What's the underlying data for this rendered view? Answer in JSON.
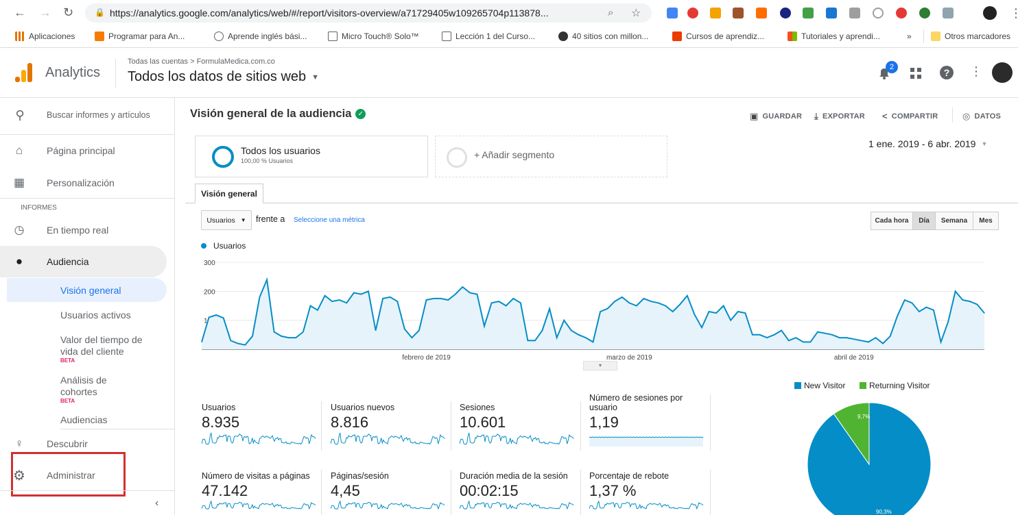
{
  "browser": {
    "url": "https://analytics.google.com/analytics/web/#/report/visitors-overview/a71729405w109265704p113878...",
    "bookmarks": [
      {
        "label": "Aplicaciones",
        "color": "#e37400"
      },
      {
        "label": "Programar para An...",
        "color": "#f57c00"
      },
      {
        "label": "Aprende inglés bási...",
        "color": "#5f6368"
      },
      {
        "label": "Micro Touch® Solo™",
        "color": "#5f6368"
      },
      {
        "label": "Lección 1 del Curso...",
        "color": "#5f6368"
      },
      {
        "label": "40 sitios con millon...",
        "color": "#333333"
      },
      {
        "label": "Cursos de aprendiz...",
        "color": "#eb3c00"
      },
      {
        "label": "Tutoriales y aprendi...",
        "color": "#f4b400"
      }
    ],
    "more_label": "»",
    "other_bookmarks": "Otros marcadores"
  },
  "header": {
    "app_name": "Analytics",
    "breadcrumb": "Todas las cuentas > FormulaMedica.com.co",
    "view_name": "Todos los datos de sitios web",
    "notification_count": "2"
  },
  "sidebar": {
    "search_placeholder": "Buscar informes y artículos",
    "home": "Página principal",
    "customization": "Personalización",
    "reports_heading": "INFORMES",
    "realtime": "En tiempo real",
    "audience": "Audiencia",
    "sub": {
      "overview": "Visión general",
      "active_users": "Usuarios activos",
      "lifetime_value": "Valor del tiempo de vida del cliente",
      "cohort": "Análisis de cohortes",
      "audiences": "Audiencias"
    },
    "beta_label": "BETA",
    "discover": "Descubrir",
    "admin": "Administrar",
    "collapse_icon": "chevron-left-icon"
  },
  "report": {
    "title": "Visión general de la audiencia",
    "actions": {
      "save": "GUARDAR",
      "export": "EXPORTAR",
      "share": "COMPARTIR",
      "insights": "DATOS"
    },
    "segment_name": "Todos los usuarios",
    "segment_sub": "100,00 % Usuarios",
    "add_segment": "+ Añadir segmento",
    "date_range": "1 ene. 2019 - 6 abr. 2019",
    "tab_overview": "Visión general",
    "metric_select": "Usuarios",
    "vs_label": "frente a",
    "select_metric_link": "Seleccione una métrica",
    "granularity": [
      "Cada hora",
      "Día",
      "Semana",
      "Mes"
    ],
    "granularity_selected": "Día"
  },
  "chart_data": {
    "type": "area",
    "series": [
      {
        "name": "Usuarios",
        "color": "#058dc7",
        "values": [
          25,
          110,
          118,
          108,
          30,
          20,
          15,
          45,
          180,
          240,
          60,
          45,
          40,
          40,
          60,
          150,
          135,
          185,
          165,
          170,
          160,
          195,
          190,
          200,
          65,
          175,
          180,
          165,
          70,
          40,
          65,
          170,
          175,
          175,
          170,
          190,
          215,
          195,
          190,
          80,
          160,
          165,
          150,
          175,
          160,
          30,
          30,
          65,
          140,
          40,
          100,
          65,
          50,
          40,
          25,
          130,
          140,
          165,
          180,
          160,
          150,
          175,
          165,
          160,
          150,
          130,
          155,
          185,
          120,
          75,
          130,
          125,
          150,
          100,
          130,
          125,
          50,
          50,
          40,
          50,
          65,
          30,
          40,
          25,
          25,
          60,
          55,
          50,
          40,
          40,
          35,
          30,
          25,
          40,
          20,
          45,
          115,
          170,
          160,
          130,
          145,
          135,
          25,
          95,
          200,
          170,
          165,
          155,
          125
        ]
      }
    ],
    "x_tick_labels": [
      "febrero de 2019",
      "marzo de 2019",
      "abril de 2019"
    ],
    "y_ticks": [
      100,
      200,
      300
    ],
    "ylim": [
      0,
      300
    ],
    "legend": "top-left"
  },
  "metrics": [
    {
      "label": "Usuarios",
      "value": "8.935"
    },
    {
      "label": "Usuarios nuevos",
      "value": "8.816"
    },
    {
      "label": "Sesiones",
      "value": "10.601"
    },
    {
      "label": "Número de sesiones por usuario",
      "value": "1,19"
    },
    {
      "label": "Número de visitas a páginas",
      "value": "47.142"
    },
    {
      "label": "Páginas/sesión",
      "value": "4,45"
    },
    {
      "label": "Duración media de la sesión",
      "value": "00:02:15"
    },
    {
      "label": "Porcentaje de rebote",
      "value": "1,37 %"
    }
  ],
  "pie": {
    "legend_new": "New Visitor",
    "legend_returning": "Returning Visitor",
    "new_color": "#058dc7",
    "returning_color": "#50b432",
    "new_pct_value": 90.3,
    "returning_pct_value": 9.7,
    "new_pct": "90,3%",
    "returning_pct": "9,7%"
  }
}
